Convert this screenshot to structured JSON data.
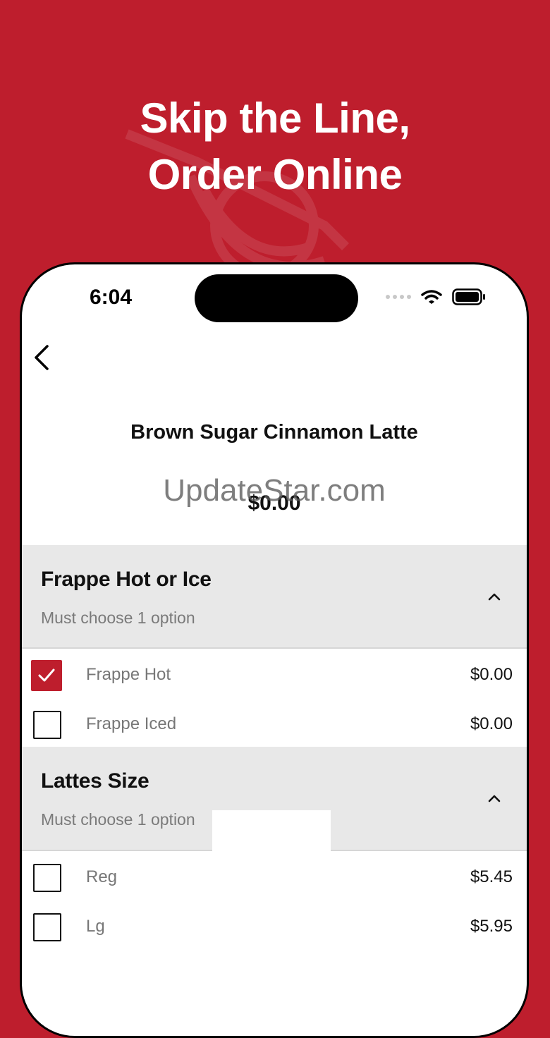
{
  "promo": {
    "line1": "Skip the Line,",
    "line2": "Order Online"
  },
  "status_bar": {
    "time": "6:04"
  },
  "product": {
    "name": "Brown Sugar Cinnamon Latte",
    "price": "$0.00"
  },
  "watermark": "UpdateStar.com",
  "sections": [
    {
      "title": "Frappe Hot or Ice",
      "subtitle": "Must choose 1 option",
      "options": [
        {
          "label": "Frappe Hot",
          "price": "$0.00",
          "checked": true
        },
        {
          "label": "Frappe Iced",
          "price": "$0.00",
          "checked": false
        }
      ]
    },
    {
      "title": "Lattes Size",
      "subtitle": "Must choose 1 option",
      "options": [
        {
          "label": "Reg",
          "price": "$5.45",
          "checked": false
        },
        {
          "label": "Lg",
          "price": "$5.95",
          "checked": false
        }
      ]
    }
  ],
  "colors": {
    "brand_red": "#BE1E2D",
    "section_bg": "#E8E8E8"
  }
}
